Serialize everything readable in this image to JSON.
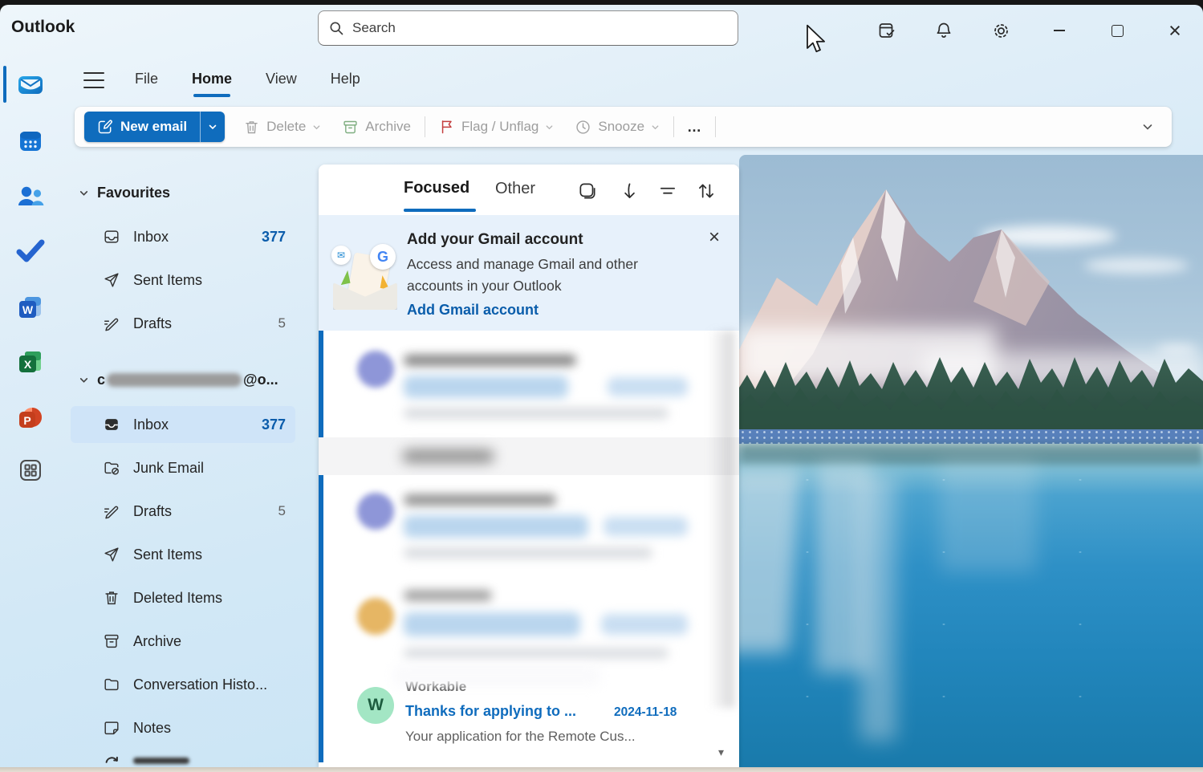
{
  "window": {
    "title": "Outlook"
  },
  "search": {
    "placeholder": "Search"
  },
  "titlebar": {
    "icons": {
      "my_day": "calendar-check",
      "notifications": "bell",
      "settings": "gear"
    },
    "controls": {
      "minimize": "minimize",
      "maximize": "maximize",
      "close": "×"
    }
  },
  "menu": {
    "items": [
      "File",
      "Home",
      "View",
      "Help"
    ],
    "active": "Home"
  },
  "toolbar": {
    "new_email": {
      "label": "New email"
    },
    "delete": {
      "label": "Delete"
    },
    "archive": {
      "label": "Archive"
    },
    "flag": {
      "label": "Flag / Unflag"
    },
    "snooze": {
      "label": "Snooze"
    },
    "more": {
      "label": "…"
    }
  },
  "app_rail": {
    "items": [
      {
        "name": "mail",
        "active": true
      },
      {
        "name": "calendar"
      },
      {
        "name": "people"
      },
      {
        "name": "to-do"
      },
      {
        "name": "word",
        "letter": "W"
      },
      {
        "name": "excel",
        "letter": "X"
      },
      {
        "name": "powerpoint",
        "letter": "P"
      },
      {
        "name": "more-apps"
      }
    ]
  },
  "folder_pane": {
    "favourites": {
      "header": "Favourites",
      "items": [
        {
          "label": "Inbox",
          "count": "377"
        },
        {
          "label": "Sent Items",
          "count": ""
        },
        {
          "label": "Drafts",
          "count": "5"
        }
      ]
    },
    "account": {
      "prefix": "c",
      "suffix": "@o...",
      "items": [
        {
          "label": "Inbox",
          "count": "377",
          "selected": true
        },
        {
          "label": "Junk Email",
          "count": ""
        },
        {
          "label": "Drafts",
          "count": "5"
        },
        {
          "label": "Sent Items",
          "count": ""
        },
        {
          "label": "Deleted Items",
          "count": ""
        },
        {
          "label": "Archive",
          "count": ""
        },
        {
          "label": "Conversation Histo...",
          "count": ""
        },
        {
          "label": "Notes",
          "count": ""
        }
      ]
    }
  },
  "message_list": {
    "tabs": [
      {
        "label": "Focused",
        "active": true
      },
      {
        "label": "Other"
      }
    ],
    "banner": {
      "title": "Add your Gmail account",
      "body": "Access and manage Gmail and other accounts in your Outlook",
      "link": "Add Gmail account",
      "close": "×",
      "google_letter": "G",
      "mail_badge_glyph": "✉"
    },
    "blurred_rows": [
      {
        "avatar_color": "#8e96d8"
      },
      {
        "avatar_color": "#8e96d8"
      },
      {
        "avatar_color": "#e6b664"
      }
    ],
    "visible_email": {
      "avatar_letter": "W",
      "avatar_color": "#a3e6c4",
      "sender": "Workable",
      "subject": "Thanks for applying to ...",
      "date": "2024-11-18",
      "preview": "Your application for the Remote Cus..."
    },
    "scroll_down_glyph": "▾"
  },
  "colors": {
    "accent": "#0f6cbd",
    "count_blue": "#0b5cab",
    "flag_red": "#c43e3e",
    "archive_green": "#7fae80",
    "banner_bg": "#e7f1fb",
    "selected_folder_bg": "#cfe4f8",
    "unread_bar": "#0f6cbd"
  }
}
